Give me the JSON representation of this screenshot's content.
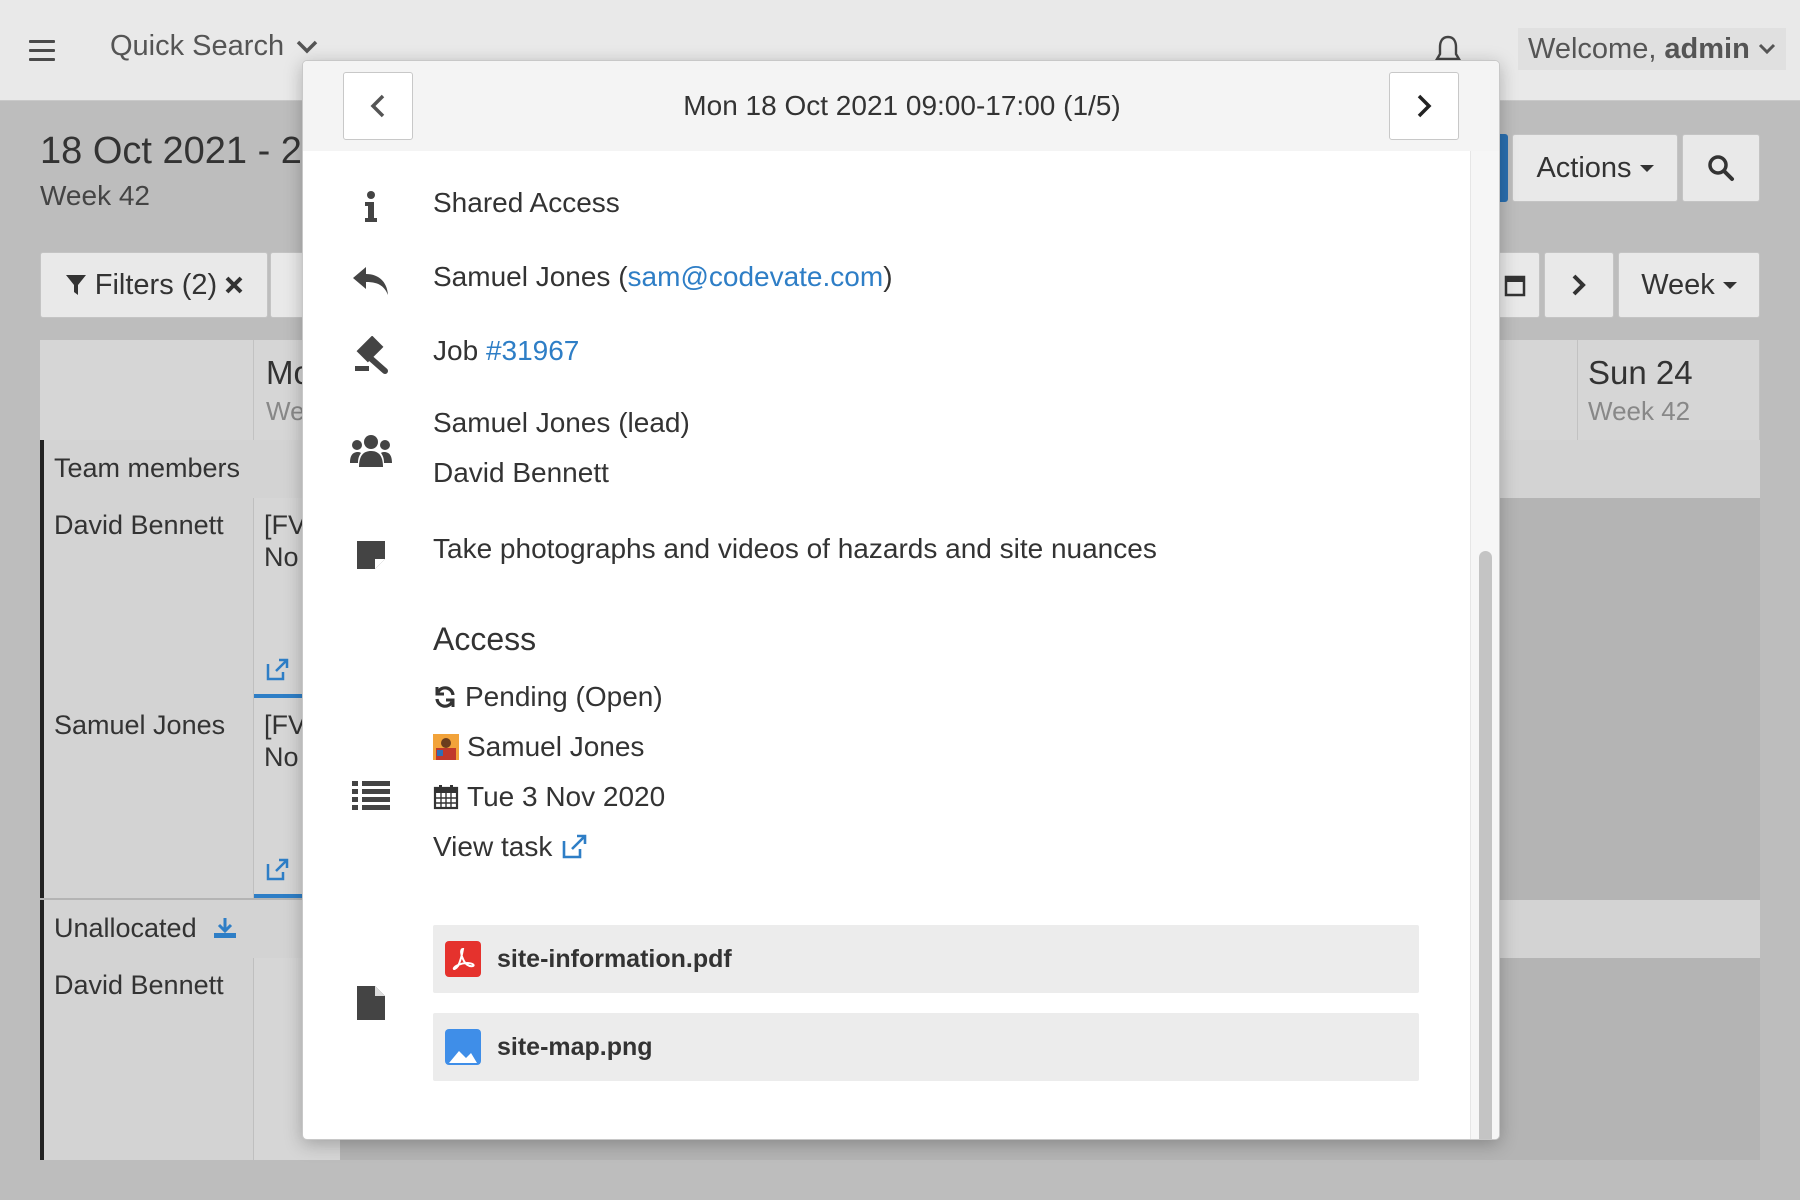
{
  "topbar": {
    "quick_search_label": "Quick Search",
    "welcome_prefix": "Welcome,",
    "welcome_user": "admin"
  },
  "page": {
    "date_range": "18 Oct 2021 - 24",
    "week_label": "Week 42"
  },
  "toolbar": {
    "actions_label": "Actions",
    "filters_label": "Filters (2)",
    "view_label": "Week"
  },
  "calendar": {
    "first_day_partial": "Mo",
    "first_day_sub_partial": "We",
    "last_day": "Sun 24",
    "last_day_sub": "Week 42",
    "team_members_label": "Team members",
    "unallocated_label": "Unallocated",
    "rows": [
      {
        "name": "David Bennett",
        "cell_line1": "[FV",
        "cell_line2": "No"
      },
      {
        "name": "Samuel Jones",
        "cell_line1": "[FV",
        "cell_line2": "No"
      }
    ],
    "unallocated_rows": [
      {
        "name": "David Bennett"
      }
    ]
  },
  "modal": {
    "title": "Mon 18 Oct 2021 09:00-17:00 (1/5)",
    "info": "Shared Access",
    "contact_name": "Samuel Jones (",
    "contact_email": "sam@codevate.com",
    "contact_close": ")",
    "job_prefix": "Job ",
    "job_link": "#31967",
    "assignees": [
      "Samuel Jones (lead)",
      "David Bennett"
    ],
    "note": "Take photographs and videos of hazards and site nuances",
    "task": {
      "heading": "Access",
      "status": "Pending (Open)",
      "assignee": "Samuel Jones",
      "date": "Tue 3 Nov 2020",
      "view_link": "View task"
    },
    "files": [
      {
        "name": "site-information.pdf",
        "type": "pdf-icon"
      },
      {
        "name": "site-map.png",
        "type": "image-icon"
      }
    ]
  },
  "colors": {
    "link": "#2e7ec6",
    "pdf": "#e5322d",
    "image": "#3f8ee8"
  }
}
